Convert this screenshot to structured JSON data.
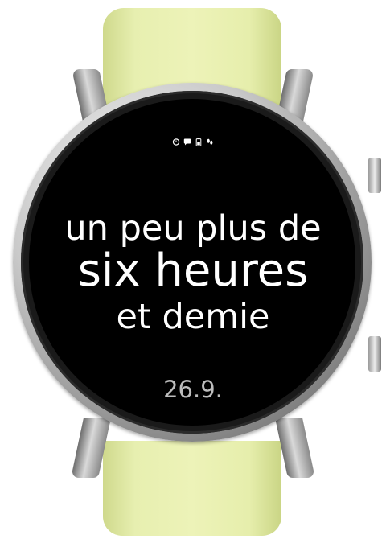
{
  "watch_face": {
    "time_text": {
      "line1": "un peu plus de",
      "line2": "six heures",
      "line3": "et demie"
    },
    "date": "26.9.",
    "status_icons": [
      "alarm-icon",
      "message-icon",
      "battery-icon",
      "steps-icon"
    ]
  },
  "colors": {
    "strap": "#e7efb0",
    "screen": "#000000",
    "text": "#ffffff",
    "date_text": "#bdbdbd"
  }
}
